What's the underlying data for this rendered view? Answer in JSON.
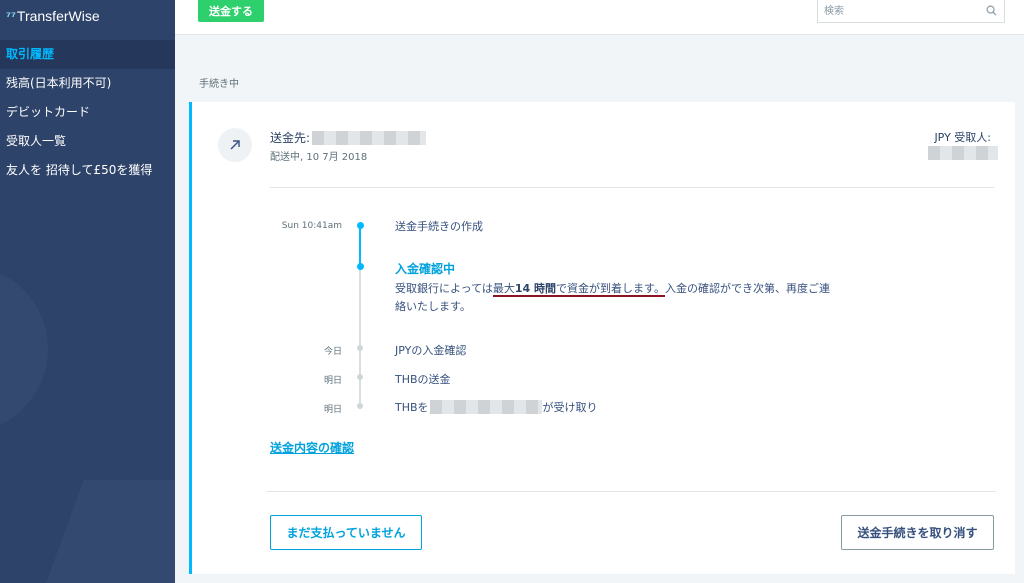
{
  "app": {
    "logo_flag": "⁷⁷",
    "logo_text": "TransferWise"
  },
  "sidebar": {
    "items": [
      {
        "label": "取引履歴",
        "active": true
      },
      {
        "label": "残高(日本利用不可)",
        "active": false
      },
      {
        "label": "デビットカード",
        "active": false
      },
      {
        "label": "受取人一覧",
        "active": false
      },
      {
        "label": "友人を 招待して£50を獲得",
        "active": false
      }
    ]
  },
  "topbar": {
    "send_label": "送金する",
    "search_placeholder": "検索",
    "search_icon": "search-icon"
  },
  "main": {
    "section_label": "手続き中",
    "transfer": {
      "icon": "arrow-up-right-icon",
      "recipient_prefix": "送金先:",
      "status_line": "配送中, 10 7月 2018",
      "currency_label": "JPY 受取人:"
    },
    "timeline": {
      "steps": [
        {
          "time": "Sun 10:41am",
          "text": "送金手続きの作成"
        },
        {
          "time": "今日",
          "text": "JPYの入金確認"
        },
        {
          "time": "明日",
          "text": "THBの送金"
        },
        {
          "time": "明日"
        }
      ],
      "active_title": "入金確認中",
      "desc_pre": "受取銀行によっては",
      "desc_hl_1": "最大",
      "desc_hl_bold": "14 時間",
      "desc_hl_2": "で資金が到着します。",
      "desc_post": "入金の確認ができ次第、再度ご連絡いたします。",
      "recv_prefix": "THBを",
      "recv_suffix": "が受け取り"
    },
    "confirm_link": "送金内容の確認",
    "not_paid_button": "まだ支払っていません",
    "cancel_button": "送金手続きを取り消す"
  },
  "colors": {
    "sidebar_bg": "#2e4369",
    "accent": "#00b9ff",
    "send_green": "#2ed06e",
    "underline_red": "#8a1424"
  }
}
